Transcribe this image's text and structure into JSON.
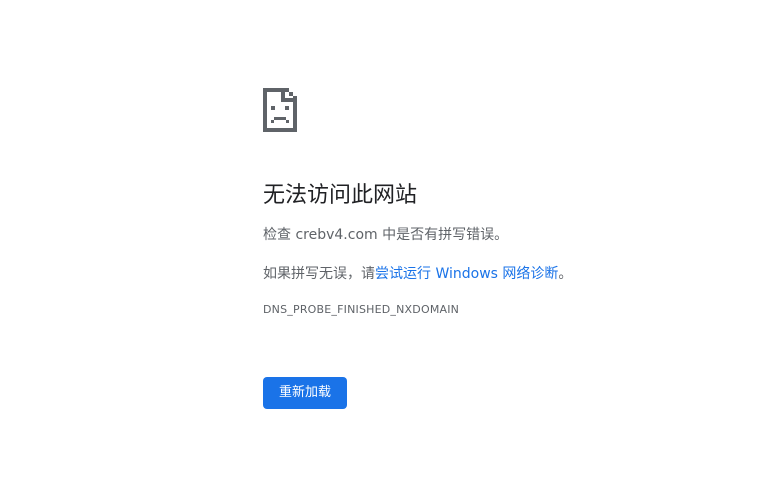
{
  "error": {
    "icon": "sad-document-icon",
    "title": "无法访问此网站",
    "check_prefix": "检查 ",
    "domain": "crebv4.com",
    "check_suffix": " 中是否有拼写错误。",
    "hint_prefix": "如果拼写无误，请",
    "hint_link": "尝试运行 Windows 网络诊断",
    "hint_suffix": "。",
    "code": "DNS_PROBE_FINISHED_NXDOMAIN"
  },
  "actions": {
    "reload_label": "重新加载"
  },
  "colors": {
    "accent": "#1a73e8",
    "title": "#202124",
    "body_text": "#5f6368",
    "icon": "#5f6368"
  }
}
